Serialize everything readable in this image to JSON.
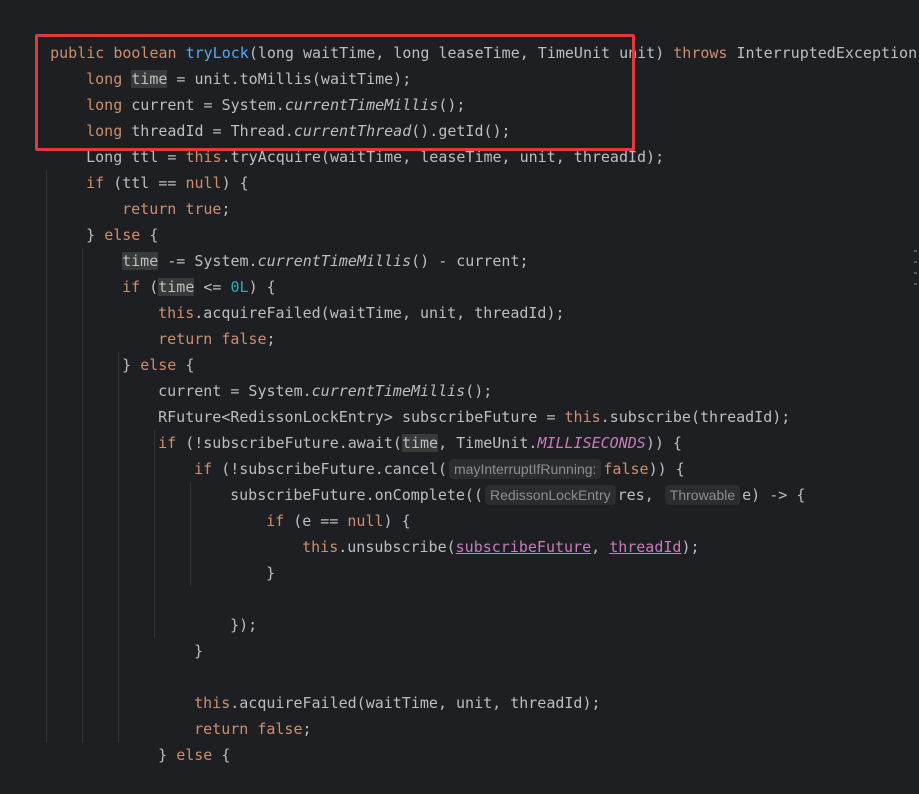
{
  "editor": {
    "lines": [
      {
        "t0": "public boolean ",
        "fn": "tryLock",
        "t1": "(long waitTime, long leaseTime, TimeUnit unit) ",
        "kw2": "throws",
        "t2": " InterruptedException {"
      },
      {
        "kw": "long",
        "sp": " ",
        "var": "time",
        "rest": " = unit.toMillis(waitTime);"
      },
      {
        "kw": "long",
        "rest": " current = System.",
        "it": "currentTimeMillis",
        "end": "();"
      },
      {
        "kw": "long",
        "rest": " threadId = Thread.",
        "it": "currentThread",
        "end": "().getId();"
      },
      {
        "t0": "Long ttl = ",
        "kw": "this",
        "rest": ".tryAcquire(waitTime, leaseTime, unit, threadId);"
      },
      {
        "kw": "if",
        "rest": " (ttl == ",
        "kw2": "null",
        "end": ") {"
      },
      {
        "kw": "return true",
        "end": ";"
      },
      {
        "t0": "} ",
        "kw": "else",
        "end": " {"
      },
      {
        "var": "time",
        "rest": " -= System.",
        "it": "currentTimeMillis",
        "end": "() - current;"
      },
      {
        "kw": "if",
        "t0": " (",
        "var": "time",
        "t1": " <= ",
        "num": "0L",
        "end": ") {"
      },
      {
        "kw": "this",
        "rest": ".acquireFailed(waitTime, unit, threadId);"
      },
      {
        "kw": "return false",
        "end": ";"
      },
      {
        "t0": "} ",
        "kw": "else",
        "end": " {"
      },
      {
        "rest": "current = System.",
        "it": "currentTimeMillis",
        "end": "();"
      },
      {
        "rest": "RFuture<RedissonLockEntry> subscribeFuture = ",
        "kw": "this",
        "end": ".subscribe(threadId);"
      },
      {
        "kw": "if",
        "t0": " (!subscribeFuture.await(",
        "var": "time",
        "t1": ", TimeUnit.",
        "const": "MILLISECONDS",
        "end": ")) {"
      },
      {
        "kw": "if",
        "t0": " (!subscribeFuture.cancel(",
        "hint": "mayInterruptIfRunning:",
        "kw2": "false",
        "end": ")) {"
      },
      {
        "t0": "subscribeFuture.onComplete((",
        "hint1": "RedissonLockEntry",
        "t1": "res, ",
        "hint2": "Throwable",
        "end": "e) -> {"
      },
      {
        "kw": "if",
        "t0": " (e == ",
        "kw2": "null",
        "end": ") {"
      },
      {
        "kw": "this",
        "t0": ".unsubscribe(",
        "u1": "subscribeFuture",
        "t1": ", ",
        "u2": "threadId",
        "end": ");"
      },
      {
        "end": "}"
      },
      {
        "end": "});"
      },
      {
        "end": "}"
      },
      {
        "kw": "this",
        "rest": ".acquireFailed(waitTime, unit, threadId);"
      },
      {
        "kw": "return false",
        "end": ";"
      },
      {
        "t0": "} ",
        "kw": "else",
        "end": " {"
      }
    ]
  }
}
